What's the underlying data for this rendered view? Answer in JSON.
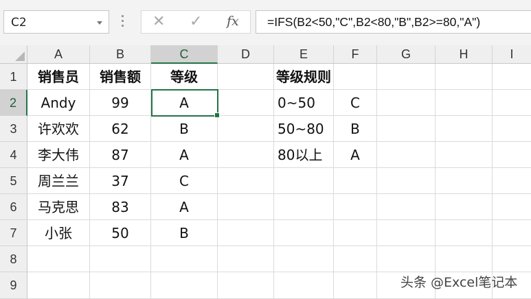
{
  "name_box": {
    "value": "C2"
  },
  "formula_bar": {
    "cancel_icon": "close-icon",
    "enter_icon": "checkmark-icon",
    "fx_label": "fx",
    "formula": "=IFS(B2<50,\"C\",B2<80,\"B\",B2>=80,\"A\")"
  },
  "grid": {
    "columns": [
      "A",
      "B",
      "C",
      "D",
      "E",
      "F",
      "G",
      "H",
      "I"
    ],
    "selected_column": "C",
    "rows": [
      "1",
      "2",
      "3",
      "4",
      "5",
      "6",
      "7",
      "8",
      "9"
    ],
    "selected_row": "2",
    "accent_color": "#217346",
    "cells": {
      "r1": {
        "A": "销售员",
        "B": "销售额",
        "C": "等级",
        "E": "等级规则"
      },
      "r2": {
        "A": "Andy",
        "B": "99",
        "C": "A",
        "E": "0~50",
        "F": "C"
      },
      "r3": {
        "A": "许欢欢",
        "B": "62",
        "C": "B",
        "E": "50~80",
        "F": "B"
      },
      "r4": {
        "A": "李大伟",
        "B": "87",
        "C": "A",
        "E": "80以上",
        "F": "A"
      },
      "r5": {
        "A": "周兰兰",
        "B": "37",
        "C": "C"
      },
      "r6": {
        "A": "马克思",
        "B": "83",
        "C": "A"
      },
      "r7": {
        "A": "小张",
        "B": "50",
        "C": "B"
      }
    }
  },
  "watermark": "头条 @Excel笔记本"
}
